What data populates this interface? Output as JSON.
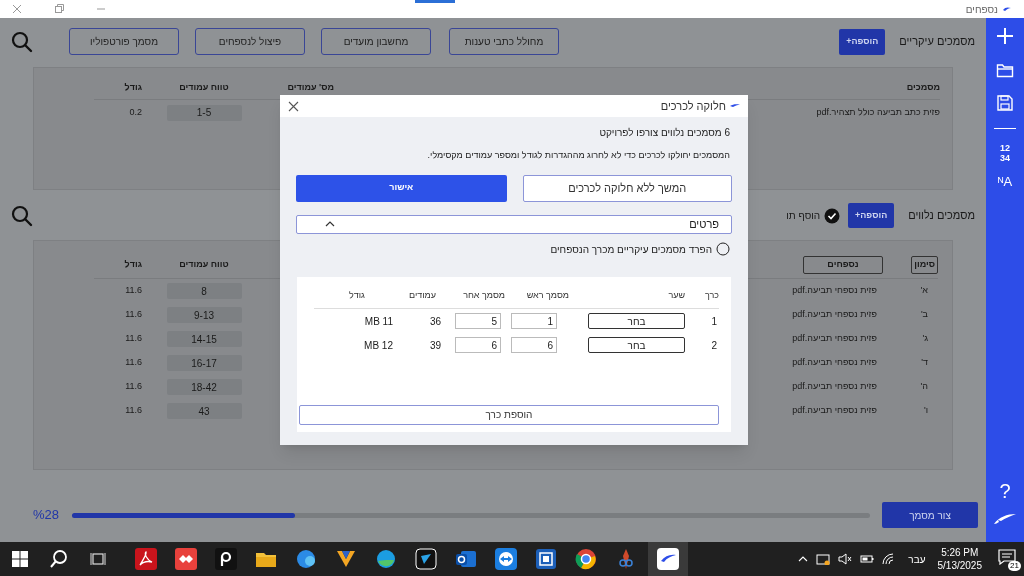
{
  "window": {
    "title": "נספחים"
  },
  "main_documents": {
    "section_title": "מסמכים עיקריים",
    "add_button": "הוספה+",
    "tool_buttons": [
      "מחולל כתבי טענות",
      "מחשבון מועדים",
      "פיצול לנספחים",
      "מסמך פורטפוליו"
    ],
    "columns": [
      "מסמכים",
      "מס' עמודים",
      "טווח עמודים",
      "גודל"
    ],
    "rows": [
      {
        "name": "פזית כתב תביעה כולל תצהיר.pdf",
        "range": "1-5",
        "size": "0.2"
      }
    ]
  },
  "attachments": {
    "section_title": "מסמכים נלווים",
    "add_button": "הוספה+",
    "option": {
      "label": "הוסף תו",
      "checked": true
    },
    "columns": [
      "סימון",
      "נספחים",
      "טווח עמודים",
      "גודל"
    ],
    "rows": [
      {
        "mark": "א'",
        "name": "פזית נספחי תביעה.pdf",
        "range": "8",
        "size": "11.6"
      },
      {
        "mark": "ב'",
        "name": "פזית נספחי תביעה.pdf",
        "range": "9-13",
        "size": "11.6"
      },
      {
        "mark": "ג'",
        "name": "פזית נספחי תביעה.pdf",
        "range": "14-15",
        "size": "11.6"
      },
      {
        "mark": "ד'",
        "name": "פזית נספחי תביעה.pdf",
        "range": "16-17",
        "size": "11.6"
      },
      {
        "mark": "ה'",
        "name": "פזית נספחי תביעה.pdf",
        "range": "18-42",
        "size": "11.6"
      },
      {
        "mark": "ו'",
        "name": "פזית נספחי תביעה.pdf",
        "range": "43",
        "size": "11.6"
      }
    ]
  },
  "progress": {
    "reading": "%28",
    "level": 0.28
  },
  "create_button": "צור מסמך",
  "sidebar": {
    "numbering": [
      "12",
      "34"
    ],
    "translate": "ᴺA",
    "help": "?"
  },
  "dialog": {
    "title": "חלוקה לכרכים",
    "summary": "6 מסמכים נלווים צורפו לפרויקט",
    "note": "המסמכים יחולקו לכרכים כדי לא לחרוג מההגדרות לגודל ומספר עמודים מקסימלי.",
    "skip_button": "המשך ללא חלוקה לכרכים",
    "confirm_button": "אישור",
    "details": {
      "label": "פרטים",
      "expanded": true
    },
    "separate": {
      "label": "הפרד מסמכים עיקריים מכרך הנספחים",
      "checked": false
    },
    "volumes": {
      "columns": [
        "כרך",
        "שער",
        "מסמך ראש",
        "מסמך אחר",
        "עמודים",
        "גודל"
      ],
      "rows": [
        {
          "volume": "1",
          "cover": "בחר",
          "first": "1",
          "last": "5",
          "pages": "36",
          "size": "MB 11"
        },
        {
          "volume": "2",
          "cover": "בחר",
          "first": "6",
          "last": "6",
          "pages": "39",
          "size": "MB 12"
        }
      ]
    },
    "add_volume": "הוספת כרך"
  },
  "taskbar": {
    "language": "עבר",
    "time": "5:26 PM",
    "date": "5/13/2025",
    "notifications": "21"
  }
}
